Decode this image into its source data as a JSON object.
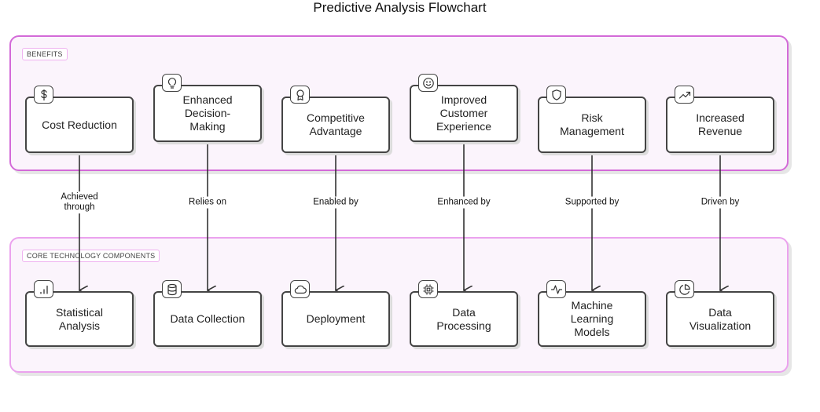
{
  "title": "Predictive Analysis Flowchart",
  "groups": {
    "benefits": {
      "label": "BENEFITS"
    },
    "core": {
      "label": "CORE TECHNOLOGY COMPONENTS"
    }
  },
  "benefits": [
    {
      "id": "cost-reduction",
      "label": "Cost Reduction",
      "icon": "dollar-icon"
    },
    {
      "id": "enhanced-decision-making",
      "label": "Enhanced\nDecision-\nMaking",
      "icon": "lightbulb-icon"
    },
    {
      "id": "competitive-advantage",
      "label": "Competitive\nAdvantage",
      "icon": "award-ribbon-icon"
    },
    {
      "id": "improved-customer-experience",
      "label": "Improved\nCustomer\nExperience",
      "icon": "smiley-icon"
    },
    {
      "id": "risk-management",
      "label": "Risk\nManagement",
      "icon": "shield-icon"
    },
    {
      "id": "increased-revenue",
      "label": "Increased\nRevenue",
      "icon": "trending-up-icon"
    }
  ],
  "components": [
    {
      "id": "statistical-analysis",
      "label": "Statistical\nAnalysis",
      "icon": "bar-chart-icon"
    },
    {
      "id": "data-collection",
      "label": "Data Collection",
      "icon": "database-icon"
    },
    {
      "id": "deployment",
      "label": "Deployment",
      "icon": "cloud-icon"
    },
    {
      "id": "data-processing",
      "label": "Data\nProcessing",
      "icon": "cpu-chip-icon"
    },
    {
      "id": "machine-learning-models",
      "label": "Machine\nLearning\nModels",
      "icon": "activity-pulse-icon"
    },
    {
      "id": "data-visualization",
      "label": "Data\nVisualization",
      "icon": "pie-chart-icon"
    }
  ],
  "edges": [
    {
      "from": "cost-reduction",
      "to": "statistical-analysis",
      "label": "Achieved\nthrough"
    },
    {
      "from": "enhanced-decision-making",
      "to": "data-collection",
      "label": "Relies on"
    },
    {
      "from": "competitive-advantage",
      "to": "deployment",
      "label": "Enabled by"
    },
    {
      "from": "improved-customer-experience",
      "to": "data-processing",
      "label": "Enhanced by"
    },
    {
      "from": "risk-management",
      "to": "machine-learning-models",
      "label": "Supported by"
    },
    {
      "from": "increased-revenue",
      "to": "data-visualization",
      "label": "Driven by"
    }
  ],
  "colors": {
    "benefits_border": "#d36ad8",
    "core_border": "#eba2ee",
    "group_fill": "#fbf4fc",
    "node_stroke": "#444444"
  }
}
